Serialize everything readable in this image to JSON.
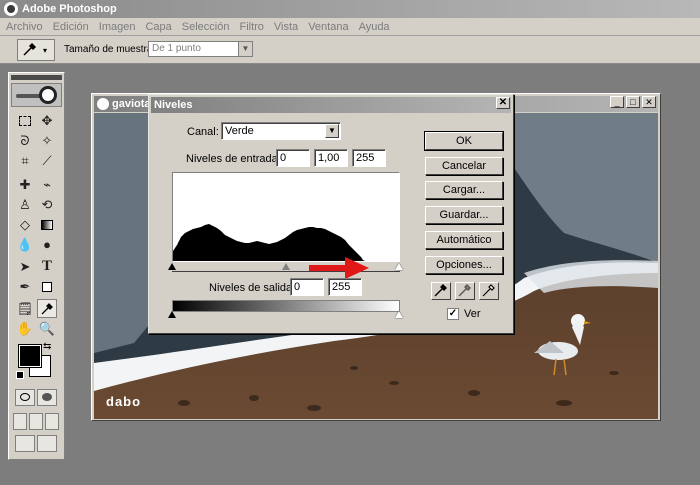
{
  "app": {
    "title": "Adobe Photoshop"
  },
  "menu": [
    "Archivo",
    "Edición",
    "Imagen",
    "Capa",
    "Selección",
    "Filtro",
    "Vista",
    "Ventana",
    "Ayuda"
  ],
  "options": {
    "sample_label": "Tamaño de muestra:",
    "sample_value": "De 1 punto"
  },
  "document": {
    "title": "gaviota"
  },
  "watermark": "dabo",
  "levels": {
    "title": "Niveles",
    "channel_label": "Canal:",
    "channel_value": "Verde",
    "input_label": "Niveles de entrada:",
    "input_black": "0",
    "input_gamma": "1,00",
    "input_white": "255",
    "output_label": "Niveles de salida:",
    "output_black": "0",
    "output_white": "255",
    "buttons": {
      "ok": "OK",
      "cancel": "Cancelar",
      "load": "Cargar...",
      "save": "Guardar...",
      "auto": "Automático",
      "options": "Opciones..."
    },
    "preview_label": "Ver",
    "preview_checked": true
  },
  "colors": {
    "annotation_arrow": "#e01818",
    "foreground": "#000000",
    "background": "#ffffff"
  }
}
